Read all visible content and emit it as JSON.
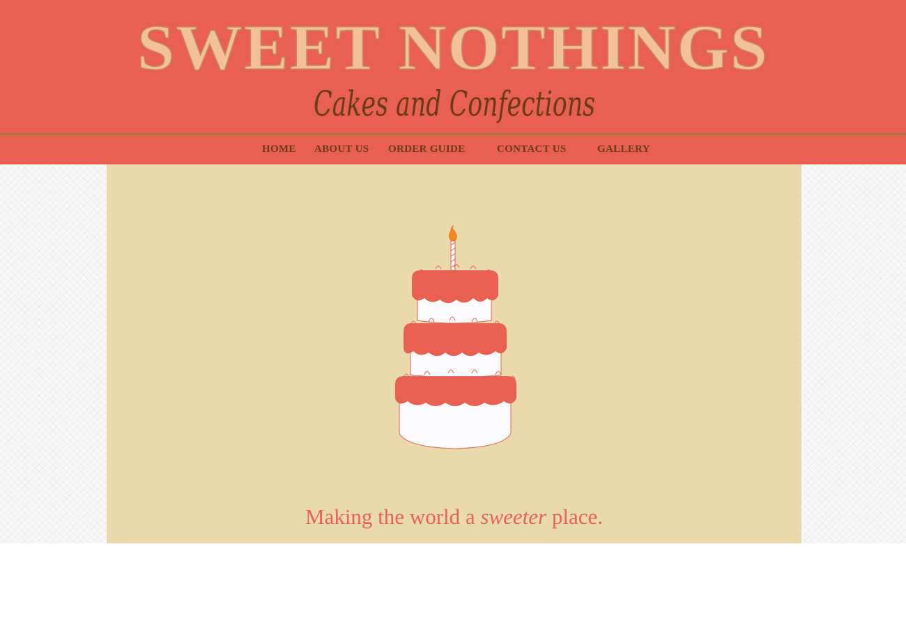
{
  "brand": {
    "title": "SWEET NOTHINGS",
    "subtitle": "Cakes and Confections"
  },
  "nav": {
    "items": [
      {
        "label": "HOME"
      },
      {
        "label": "ABOUT US"
      },
      {
        "label": "ORDER GUIDE"
      },
      {
        "label": "CONTACT US"
      },
      {
        "label": "GALLERY"
      }
    ]
  },
  "hero": {
    "image": "tiered-birthday-cake-illustration",
    "tagline_before": "Making the world a ",
    "tagline_emphasis": "sweeter",
    "tagline_after": " place."
  },
  "colors": {
    "header_bg": "#e86052",
    "panel_bg": "#e9d9ad",
    "title_fill": "#f1c29a",
    "nav_text": "#6b3a17",
    "rule": "#a5773f",
    "tagline": "#e8625a"
  }
}
